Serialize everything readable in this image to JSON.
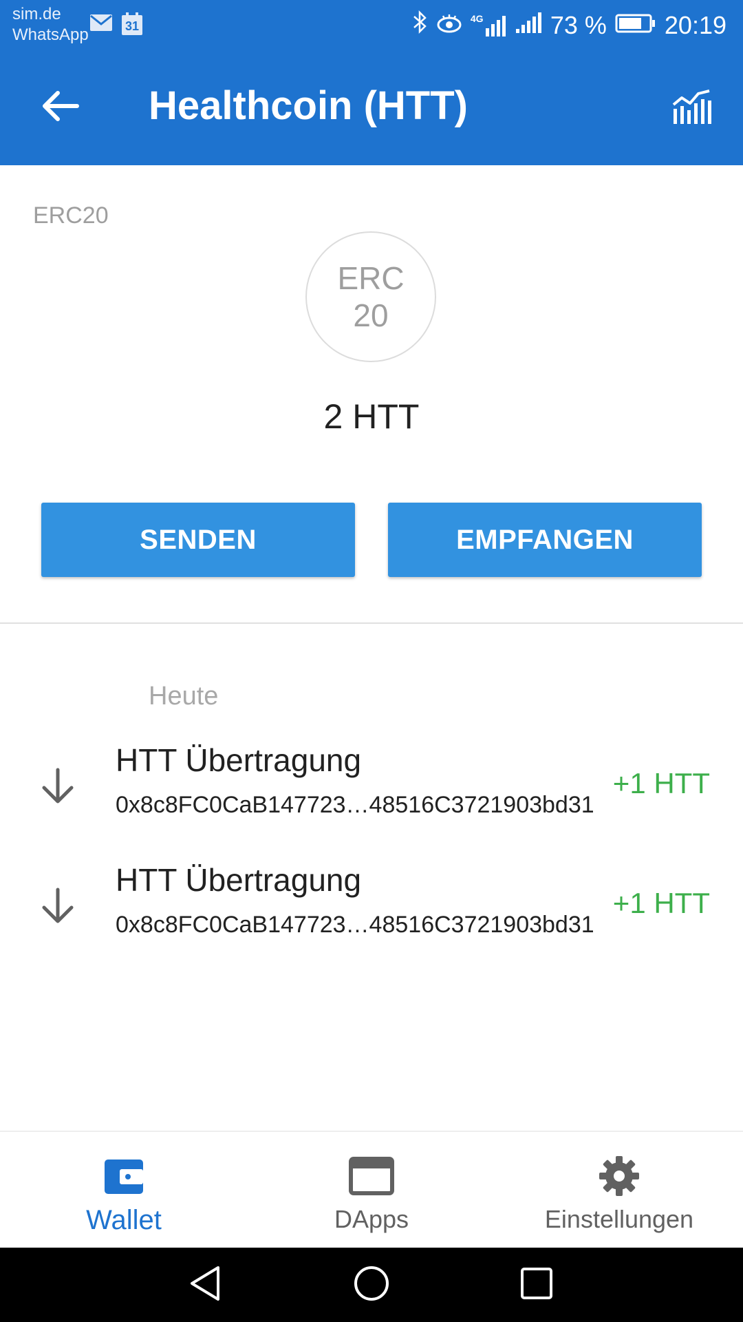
{
  "status_bar": {
    "carrier_line1": "sim.de",
    "carrier_line2": "WhatsApp",
    "calendar_day": "31",
    "network": "4G",
    "battery": "73 %",
    "time": "20:19"
  },
  "app_bar": {
    "title": "Healthcoin (HTT)"
  },
  "token": {
    "type_label": "ERC20",
    "icon_line1": "ERC",
    "icon_line2": "20",
    "balance": "2 HTT"
  },
  "actions": {
    "send_label": "SENDEN",
    "receive_label": "EMPFANGEN"
  },
  "transactions": {
    "section_header": "Heute",
    "items": [
      {
        "title": "HTT Übertragung",
        "address": "0x8c8FC0CaB147723…48516C3721903bd31",
        "amount": "+1 HTT"
      },
      {
        "title": "HTT Übertragung",
        "address": "0x8c8FC0CaB147723…48516C3721903bd31",
        "amount": "+1 HTT"
      }
    ]
  },
  "bottom_nav": {
    "items": [
      {
        "label": "Wallet",
        "icon": "wallet-icon",
        "active": true
      },
      {
        "label": "DApps",
        "icon": "browser-window-icon",
        "active": false
      },
      {
        "label": "Einstellungen",
        "icon": "gear-icon",
        "active": false
      }
    ]
  },
  "colors": {
    "primary": "#1E73CF",
    "button": "#3292E0",
    "positive_amount": "#3DAF4B"
  }
}
